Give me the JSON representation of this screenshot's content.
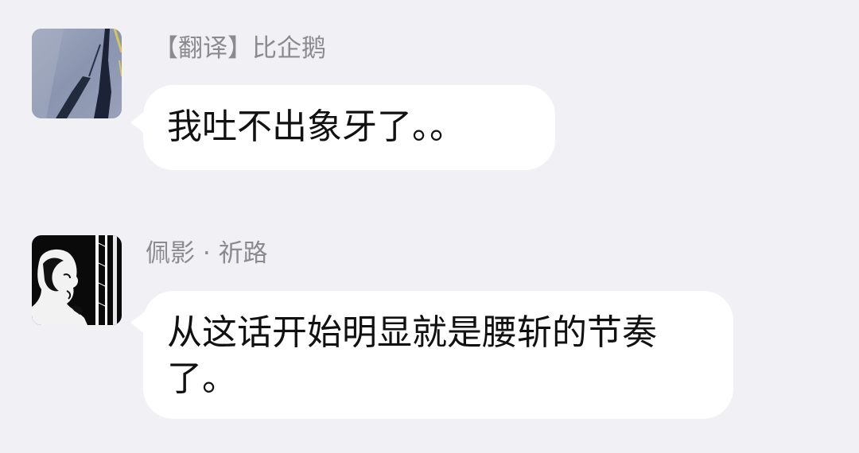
{
  "messages": [
    {
      "sender": "【翻译】比企鹅",
      "text": "我吐不出象牙了。。",
      "avatar": "road-shadow-avatar"
    },
    {
      "sender": "佩影 · 祈路",
      "text": "从这话开始明显就是腰斩的节奏了。",
      "avatar": "silhouette-portrait-avatar"
    }
  ],
  "colors": {
    "background": "#f1f1f5",
    "bubble": "#ffffff",
    "sender_text": "#8a8a90",
    "message_text": "#111111"
  }
}
